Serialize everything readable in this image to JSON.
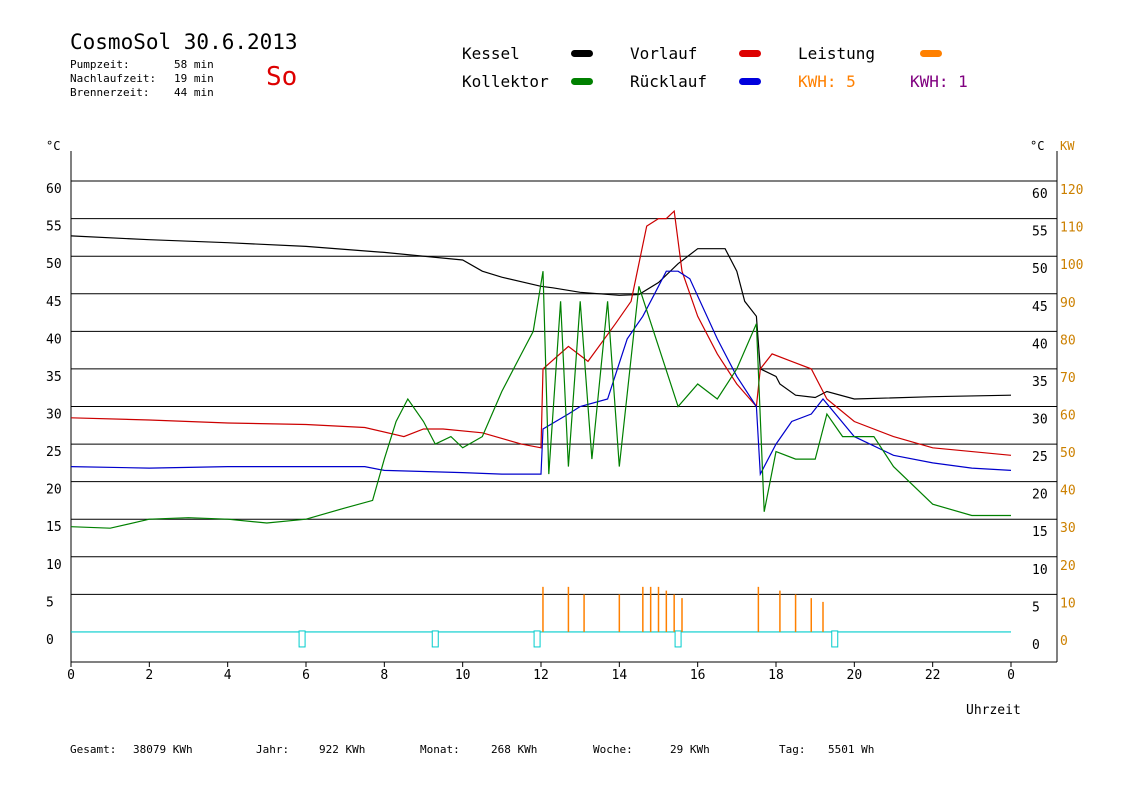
{
  "header": {
    "title": "CosmoSol 30.6.2013",
    "day": "So",
    "pump_label": "Pumpzeit:",
    "pump_value": "58 min",
    "nachlauf_label": "Nachlaufzeit:",
    "nachlauf_value": "19 min",
    "brenner_label": "Brennerzeit:",
    "brenner_value": "44 min"
  },
  "legend": {
    "kessel": "Kessel",
    "kollektor": "Kollektor",
    "vorlauf": "Vorlauf",
    "ruecklauf": "Rücklauf",
    "leistung": "Leistung",
    "kwh_a": "KWH: 5",
    "kwh_b": "KWH: 1"
  },
  "colors": {
    "kessel": "#000000",
    "kollektor": "#008000",
    "vorlauf": "#cc0000",
    "ruecklauf": "#0000cc",
    "leistung": "#ff8000",
    "kwh_b": "#800080",
    "pump": "#00cccc",
    "right_axis": "#cc8000",
    "day": "#dd0000"
  },
  "footer": {
    "gesamt_label": "Gesamt:",
    "gesamt_value": "38079 KWh",
    "jahr_label": "Jahr:",
    "jahr_value": "922 KWh",
    "monat_label": "Monat:",
    "monat_value": "268 KWh",
    "woche_label": "Woche:",
    "woche_value": "29 KWh",
    "tag_label": "Tag:",
    "tag_value": "5501 Wh"
  },
  "chart_data": {
    "type": "line",
    "xlabel": "Uhrzeit",
    "ylabel": "°C",
    "ylabel_right_1": "°C",
    "ylabel_right_2": "KW",
    "xlim": [
      0,
      24
    ],
    "ylim": [
      -4,
      64
    ],
    "ylim_right_kw": [
      -8,
      128
    ],
    "x_ticks": [
      "0",
      "2",
      "4",
      "6",
      "8",
      "10",
      "12",
      "14",
      "16",
      "18",
      "20",
      "22",
      "0"
    ],
    "y_ticks": [
      0,
      5,
      10,
      15,
      20,
      25,
      30,
      35,
      40,
      45,
      50,
      55,
      60
    ],
    "y_ticks_right_kw": [
      0,
      10,
      20,
      30,
      40,
      50,
      60,
      70,
      80,
      90,
      100,
      110,
      120
    ],
    "grid": "horizontal",
    "series": [
      {
        "name": "Kessel",
        "color": "#000000",
        "x": [
          0,
          2,
          4,
          6,
          8,
          10,
          10.5,
          11,
          12,
          12.3,
          13,
          14,
          14.5,
          15,
          15.5,
          16,
          16.7,
          17,
          17.2,
          17.5,
          17.6,
          18,
          18.1,
          18.5,
          19,
          19.3,
          20,
          22,
          24
        ],
        "y": [
          52.7,
          52.2,
          51.8,
          51.3,
          50.5,
          49.5,
          48,
          47.2,
          46,
          45.8,
          45.2,
          44.8,
          44.9,
          46.5,
          49,
          51,
          51,
          48,
          44,
          42,
          35,
          34,
          33,
          31.5,
          31.2,
          32,
          31,
          31.3,
          31.5
        ]
      },
      {
        "name": "Vorlauf",
        "color": "#cc0000",
        "x": [
          0,
          2,
          4,
          6,
          7.5,
          8.5,
          9,
          9.5,
          10.5,
          11.5,
          12,
          12.05,
          12.7,
          13.2,
          13.9,
          14.3,
          14.7,
          15,
          15.2,
          15.4,
          15.6,
          16,
          16.5,
          17,
          17.5,
          17.6,
          17.9,
          18.4,
          18.9,
          19.3,
          20,
          21,
          22,
          24
        ],
        "y": [
          28.5,
          28.2,
          27.8,
          27.6,
          27.2,
          26,
          27,
          27,
          26.5,
          25,
          24.5,
          35,
          38,
          36,
          41,
          44,
          54,
          55,
          55,
          56,
          48,
          42,
          37,
          33,
          30,
          35,
          37,
          36,
          35,
          31,
          28,
          26,
          24.5,
          23.5
        ]
      },
      {
        "name": "Rücklauf",
        "color": "#0000cc",
        "x": [
          0,
          2,
          4,
          6,
          7.5,
          8,
          10,
          11,
          12,
          12.05,
          12.7,
          13,
          13.7,
          14.2,
          14.6,
          14.9,
          15.2,
          15.5,
          15.8,
          16.5,
          17,
          17.5,
          17.6,
          18,
          18.4,
          18.9,
          19.2,
          20,
          21,
          22,
          23,
          24
        ],
        "y": [
          22,
          21.8,
          22,
          22,
          22,
          21.5,
          21.2,
          21,
          21,
          27,
          29,
          30,
          31,
          39,
          42,
          45,
          48,
          48,
          47,
          39,
          34,
          30,
          21,
          25,
          28,
          29,
          31,
          26,
          23.5,
          22.5,
          21.8,
          21.5
        ]
      },
      {
        "name": "Kollektor",
        "color": "#008000",
        "x": [
          0,
          1,
          2,
          3,
          4,
          5,
          6,
          7,
          7.7,
          8,
          8.3,
          8.6,
          9,
          9.3,
          9.7,
          10,
          10.5,
          11,
          11.5,
          11.8,
          12.05,
          12.2,
          12.5,
          12.7,
          13,
          13.3,
          13.7,
          14,
          14.5,
          15,
          15.5,
          16,
          16.5,
          17,
          17.5,
          17.7,
          18,
          18.5,
          19,
          19.3,
          19.7,
          20,
          20.5,
          21,
          22,
          23,
          24
        ],
        "y": [
          14,
          13.8,
          15,
          15.2,
          15,
          14.5,
          15,
          16.5,
          17.5,
          23,
          28,
          31,
          28,
          25,
          26,
          24.5,
          26,
          32,
          37,
          40,
          48,
          21,
          44,
          22,
          44,
          23,
          44,
          22,
          46,
          38,
          30,
          33,
          31,
          35,
          41,
          16,
          24,
          23,
          23,
          29,
          26,
          26,
          26,
          22,
          17,
          15.5,
          15.5
        ]
      }
    ],
    "power_kw": {
      "name": "Leistung",
      "color": "#ff8000",
      "x": [
        12.05,
        12.7,
        13.1,
        14,
        14.6,
        14.8,
        15,
        15.2,
        15.4,
        15.6,
        17.55,
        18.1,
        18.5,
        18.9,
        19.2
      ],
      "y": [
        12,
        12,
        10,
        10,
        12,
        12,
        12,
        11,
        10,
        9,
        12,
        11,
        10,
        9,
        8
      ]
    },
    "pump_markers_x": [
      5.9,
      9.3,
      11.9,
      15.5,
      19.5
    ]
  }
}
